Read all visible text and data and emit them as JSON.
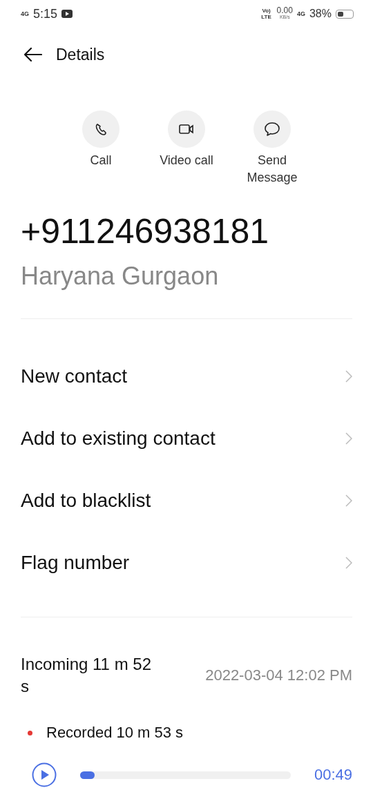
{
  "status_bar": {
    "network": "4G",
    "time": "5:15",
    "volte": "Vo) LTE",
    "speed": "0.00",
    "speed_unit": "KB/s",
    "network_2": "4G",
    "battery": "38%"
  },
  "header": {
    "title": "Details"
  },
  "actions": [
    {
      "kind": "call",
      "label": "Call"
    },
    {
      "kind": "video",
      "label": "Video call"
    },
    {
      "kind": "message",
      "label": "Send Message"
    }
  ],
  "number": "+911246938181",
  "location": "Haryana Gurgaon",
  "menu": [
    "New contact",
    "Add to existing contact",
    "Add to blacklist",
    "Flag number"
  ],
  "call_log": {
    "type_duration": "Incoming 11 m 52 s",
    "timestamp": "2022-03-04 12:02 PM",
    "recording": {
      "label": "Recorded 10 m 53 s",
      "color": "#e53935",
      "level": 0.07,
      "time": "00:49"
    }
  }
}
